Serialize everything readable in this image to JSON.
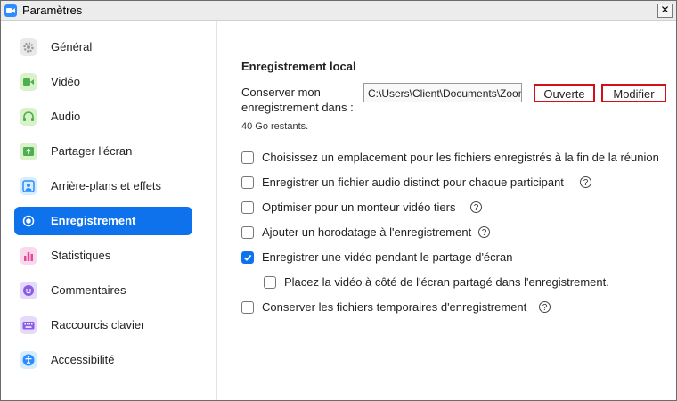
{
  "window": {
    "title": "Paramètres",
    "close_glyph": "✕"
  },
  "sidebar": {
    "items": [
      {
        "label": "Général",
        "icon": "gear-icon",
        "color": "#E9E9E9"
      },
      {
        "label": "Vidéo",
        "icon": "video-icon",
        "color": "#D9F2C9"
      },
      {
        "label": "Audio",
        "icon": "headphones-icon",
        "color": "#D9F2C9"
      },
      {
        "label": "Partager l'écran",
        "icon": "share-screen-icon",
        "color": "#D9F2C9"
      },
      {
        "label": "Arrière-plans et effets",
        "icon": "background-icon",
        "color": "#D6ECFF"
      },
      {
        "label": "Enregistrement",
        "icon": "record-icon",
        "color": "#0E72ED",
        "active": true
      },
      {
        "label": "Statistiques",
        "icon": "statistics-icon",
        "color": "#FBD9EC"
      },
      {
        "label": "Commentaires",
        "icon": "feedback-icon",
        "color": "#E6DAFB"
      },
      {
        "label": "Raccourcis clavier",
        "icon": "keyboard-icon",
        "color": "#E6DAFB"
      },
      {
        "label": "Accessibilité",
        "icon": "accessibility-icon",
        "color": "#D6ECFF"
      }
    ]
  },
  "recording": {
    "section_title": "Enregistrement local",
    "path_label": "Conserver mon enregistrement dans :",
    "path_value": "C:\\Users\\Client\\Documents\\Zoom",
    "open_button": "Ouverte",
    "modify_button": "Modifier",
    "remaining": "40 Go restants.",
    "options": [
      {
        "label": "Choisissez un emplacement pour les fichiers enregistrés à la fin de la réunion",
        "checked": false,
        "help": false
      },
      {
        "label": "Enregistrer un fichier audio distinct pour chaque participant",
        "checked": false,
        "help": true
      },
      {
        "label": "Optimiser pour un monteur vidéo tiers",
        "checked": false,
        "help": true
      },
      {
        "label": "Ajouter un horodatage à l'enregistrement",
        "checked": false,
        "help": true
      },
      {
        "label": "Enregistrer une vidéo pendant le partage d'écran",
        "checked": true,
        "help": false
      },
      {
        "label": "Placez la vidéo à côté de l'écran partagé dans l'enregistrement.",
        "checked": false,
        "help": false
      },
      {
        "label": "Conserver les fichiers temporaires d'enregistrement",
        "checked": false,
        "help": true
      }
    ],
    "help_glyph": "?"
  },
  "colors": {
    "accent": "#0E72ED",
    "highlight_border": "#D0101B"
  }
}
